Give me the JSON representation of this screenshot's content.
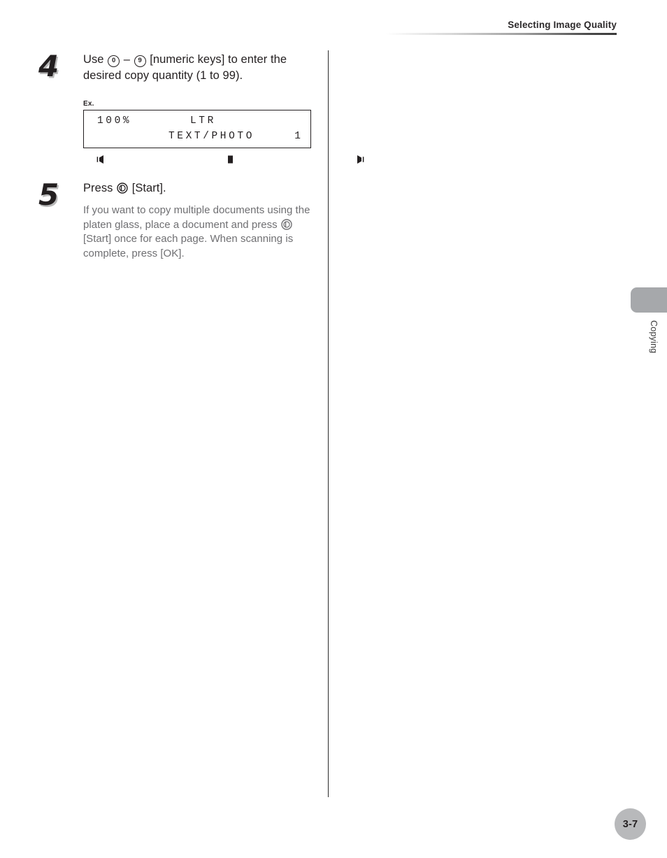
{
  "header": {
    "title": "Selecting Image Quality"
  },
  "side_tab": {
    "label": "Copying"
  },
  "footer": {
    "page_number": "3-7"
  },
  "steps": [
    {
      "number": "4",
      "title_part1": "Use ",
      "key_low": "0",
      "title_dash": " – ",
      "key_high": "9",
      "title_part2": " [numeric keys] to enter the desired copy quantity (1 to 99)."
    },
    {
      "number": "5",
      "title_part1": "Press ",
      "title_part2": " [Start].",
      "note_part1": "If you want to copy multiple documents using the platen glass, place a document and press ",
      "note_part2": " [Start] once for each page. When scanning is complete, press [OK]."
    }
  ],
  "lcd_example": {
    "ex_label": "Ex.",
    "line1_left": "100%",
    "line1_center": "LTR",
    "line2_center": "TEXT/PHOTO",
    "line2_right": "1",
    "density_icons": [
      "density-light-icon",
      "density-center-icon",
      "density-dark-icon"
    ]
  },
  "colors": {
    "text": "#231f20",
    "muted": "#6f6f72",
    "tab": "#a6a8ab",
    "badge": "#b8b9bb"
  }
}
